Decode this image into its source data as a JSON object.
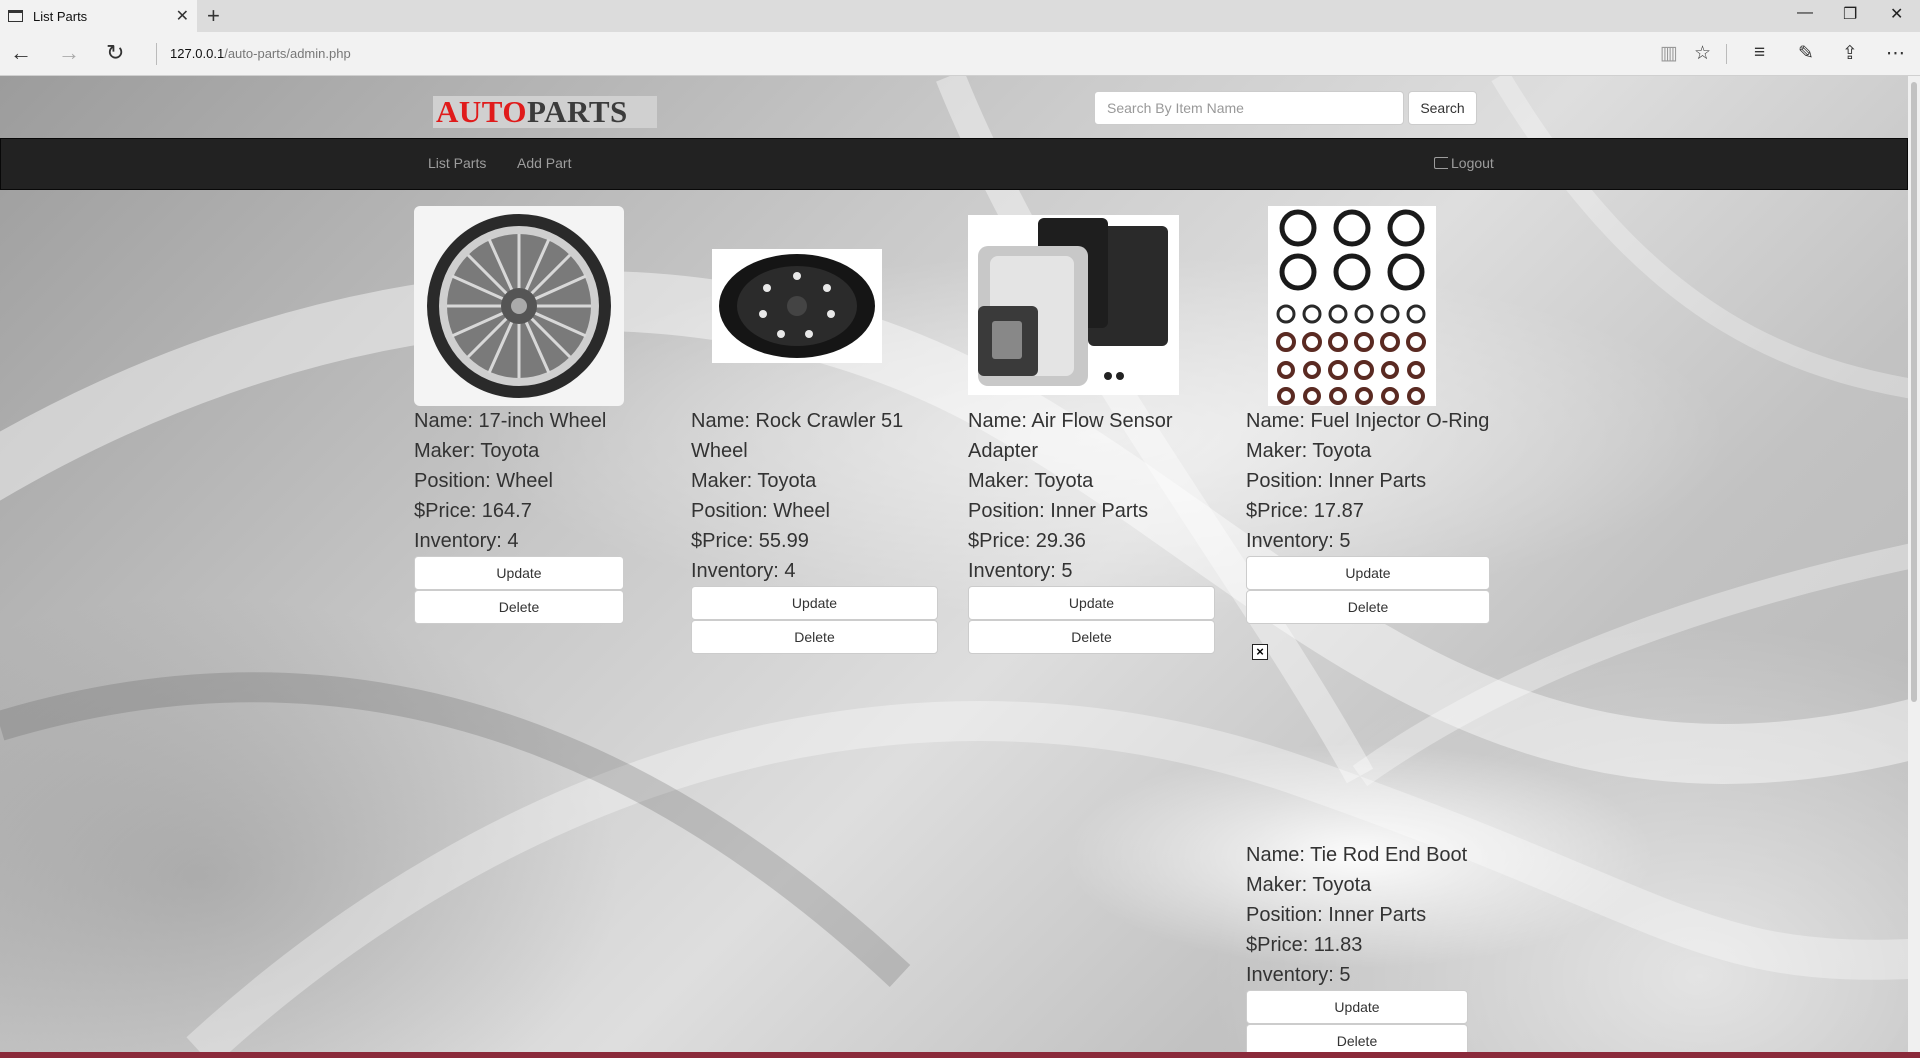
{
  "browser": {
    "tab_title": "List Parts",
    "url_host": "127.0.0.1",
    "url_path": "/auto-parts/admin.php"
  },
  "site": {
    "logo_auto": "AUTO",
    "logo_parts": "PARTS",
    "search_placeholder": "Search By Item Name",
    "search_label": "Search"
  },
  "nav": {
    "items": [
      {
        "label": "List Parts"
      },
      {
        "label": "Add Part"
      }
    ],
    "logout_label": "Logout"
  },
  "parts": [
    {
      "name": "Name: 17-inch Wheel",
      "maker": "Maker: Toyota",
      "position": "Position: Wheel",
      "price": "$Price: 164.7",
      "inventory": "Inventory: 4",
      "update": "Update",
      "delete": "Delete"
    },
    {
      "name": "Name: Rock Crawler 51 Wheel",
      "maker": "Maker: Toyota",
      "position": "Position: Wheel",
      "price": "$Price: 55.99",
      "inventory": "Inventory: 4",
      "update": "Update",
      "delete": "Delete"
    },
    {
      "name": "Name: Air Flow Sensor Adapter",
      "maker": "Maker: Toyota",
      "position": "Position: Inner Parts",
      "price": "$Price: 29.36",
      "inventory": "Inventory: 5",
      "update": "Update",
      "delete": "Delete"
    },
    {
      "name": "Name: Fuel Injector O-Ring",
      "maker": "Maker: Toyota",
      "position": "Position: Inner Parts",
      "price": "$Price: 17.87",
      "inventory": "Inventory: 5",
      "update": "Update",
      "delete": "Delete"
    },
    {
      "name": "Name: Tie Rod End Boot",
      "maker": "Maker: Toyota",
      "position": "Position: Inner Parts",
      "price": "$Price: 11.83",
      "inventory": "Inventory: 5",
      "update": "Update",
      "delete": "Delete"
    }
  ]
}
